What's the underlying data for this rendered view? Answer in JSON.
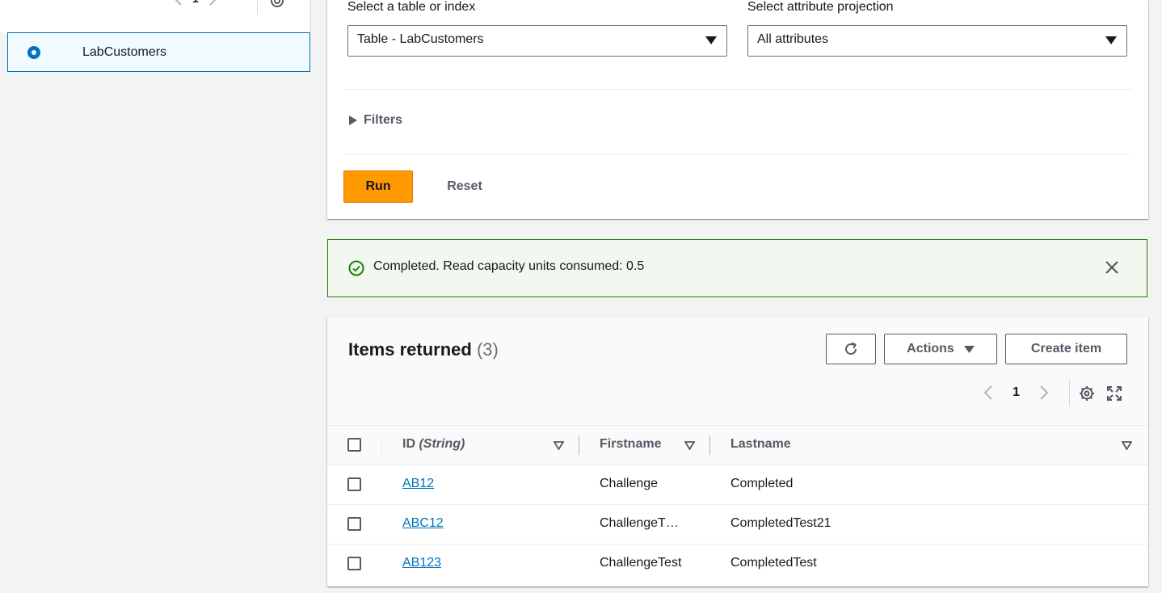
{
  "left_panel": {
    "page_number": "1",
    "selected_table": "LabCustomers"
  },
  "query": {
    "table_label": "Select a table or index",
    "table_value": "Table - LabCustomers",
    "projection_label": "Select attribute projection",
    "projection_value": "All attributes",
    "filters_label": "Filters",
    "run_label": "Run",
    "reset_label": "Reset"
  },
  "alert": {
    "message": "Completed. Read capacity units consumed: 0.5",
    "status_color": "#1d8102"
  },
  "results": {
    "title": "Items returned",
    "count": "(3)",
    "actions_label": "Actions",
    "create_label": "Create item",
    "page_number": "1",
    "columns": {
      "id": "ID",
      "id_type": "(String)",
      "firstname": "Firstname",
      "lastname": "Lastname"
    },
    "rows": [
      {
        "id": "AB12",
        "firstname": "Challenge",
        "lastname": "Completed"
      },
      {
        "id": "ABC12",
        "firstname": "ChallengeT…",
        "lastname": "CompletedTest21"
      },
      {
        "id": "AB123",
        "firstname": "ChallengeTest",
        "lastname": "CompletedTest"
      }
    ]
  },
  "colors": {
    "primary": "#ff9900",
    "link": "#0073bb",
    "success": "#1d8102"
  },
  "icons": [
    "chevron-left-icon",
    "chevron-right-icon",
    "gear-icon",
    "caret-down-icon",
    "caret-right-icon",
    "check-circle-icon",
    "close-icon",
    "refresh-icon",
    "expand-icon",
    "sort-icon"
  ]
}
